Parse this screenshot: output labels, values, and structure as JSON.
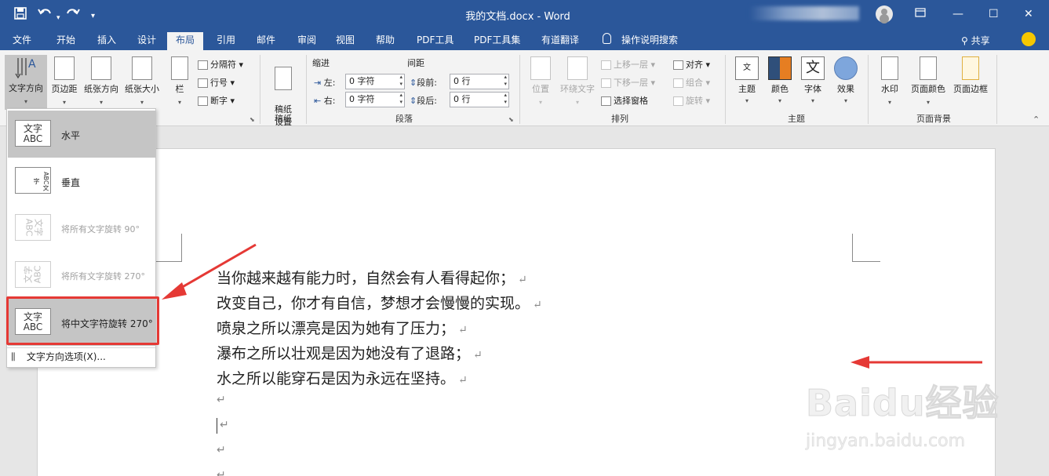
{
  "titlebar": {
    "document_title": "我的文档.docx  -  Word",
    "save_icon": "save-icon",
    "undo_icon": "undo-icon",
    "redo_icon": "redo-icon",
    "customize_icon": "chevron-down-icon",
    "minimize": "—",
    "restore": "❐",
    "maximize": "☐",
    "close": "✕"
  },
  "tabs": [
    "文件",
    "开始",
    "插入",
    "设计",
    "布局",
    "引用",
    "邮件",
    "审阅",
    "视图",
    "帮助",
    "PDF工具",
    "PDF工具集",
    "有道翻译",
    "操作说明搜索"
  ],
  "active_tab": "布局",
  "share_label": "共享",
  "ribbon": {
    "text_direction": "文字方向",
    "margins": "页边距",
    "orientation": "纸张方向",
    "size": "纸张大小",
    "columns": "栏",
    "breaks": "分隔符",
    "line_numbers": "行号",
    "hyphenation": "断字",
    "paper_settings": "稿纸\n设置",
    "paper_group": "稿纸",
    "indent_label": "缩进",
    "spacing_label": "间距",
    "indent_left_label": "左:",
    "indent_left_value": "0 字符",
    "indent_right_label": "右:",
    "indent_right_value": "0 字符",
    "spacing_before_label": "段前:",
    "spacing_before_value": "0 行",
    "spacing_after_label": "段后:",
    "spacing_after_value": "0 行",
    "paragraph_group": "段落",
    "position": "位置",
    "wrap_text": "环绕文字",
    "bring_forward": "上移一层",
    "send_backward": "下移一层",
    "selection_pane": "选择窗格",
    "align": "对齐",
    "group": "组合",
    "rotate": "旋转",
    "arrange_group": "排列",
    "themes": "主题",
    "colors": "颜色",
    "fonts": "字体",
    "effects": "效果",
    "theme_group": "主题",
    "watermark": "水印",
    "page_color": "页面颜色",
    "page_borders": "页面边框",
    "page_background_group": "页面背景"
  },
  "text_direction_menu": {
    "items": [
      {
        "label": "水平",
        "icon_text": "文字\nABC"
      },
      {
        "label": "垂直",
        "icon_text": "ABC文字"
      },
      {
        "label": "将所有文字旋转 90°",
        "icon_text": "文字\nABC"
      },
      {
        "label": "将所有文字旋转 270°",
        "icon_text": "文字\nABC"
      },
      {
        "label": "将中文字符旋转 270°",
        "icon_text": "文字\nABC"
      }
    ],
    "options_label": "文字方向选项(X)..."
  },
  "document": {
    "lines": [
      "当你越来越有能力时，自然会有人看得起你；",
      "改变自己，你才有自信，梦想才会慢慢的实现。",
      "喷泉之所以漂亮是因为她有了压力；",
      "瀑布之所以壮观是因为她没有了退路；",
      "水之所以能穿石是因为永远在坚持。"
    ],
    "paragraph_mark": "↵"
  },
  "watermark": {
    "brand": "Baidu经验",
    "site": "jingyan.baidu.com"
  },
  "colors": {
    "title_bar": "#2b579a",
    "ribbon_bg": "#f3f3f3",
    "annotation_red": "#e53935"
  }
}
